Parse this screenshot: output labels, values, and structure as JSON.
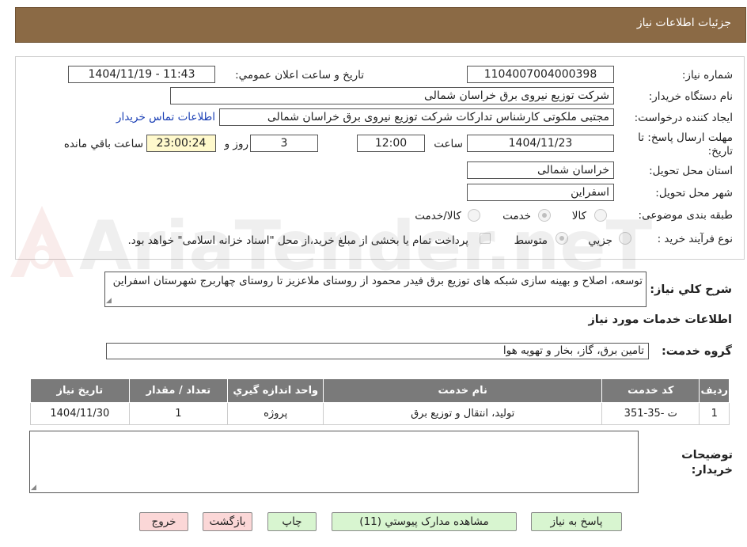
{
  "page": {
    "title": "جزئيات اطلاعات نياز"
  },
  "form": {
    "need_number_label": "شماره نياز:",
    "need_number": "1104007004000398",
    "announce_label": "تاريخ و ساعت اعلان عمومي:",
    "announce_value": "1404/11/19 - 11:43",
    "buyer_org_label": "نام دستگاه خريدار:",
    "buyer_org": "شرکت توزیع نیروی برق خراسان شمالی",
    "creator_label": "ايجاد کننده درخواست:",
    "creator": "مجتبی ملکوتی کارشناس تدارکات شرکت توزیع نیروی برق خراسان شمالی",
    "contact_link": "اطلاعات تماس خريدار",
    "deadline_label": "مهلت ارسال پاسخ: تا تاريخ:",
    "deadline_date": "1404/11/23",
    "time_label": "ساعت",
    "deadline_time": "12:00",
    "days_value": "3",
    "days_label": "روز و",
    "remaining_time": "23:00:24",
    "remaining_label": "ساعت باقي مانده",
    "province_label": "استان محل تحويل:",
    "province": "خراسان شمالی",
    "city_label": "شهر محل تحويل:",
    "city": "اسفراین",
    "category_label": "طبقه بندی موضوعی:",
    "category_options": [
      "کالا",
      "خدمت",
      "کالا/خدمت"
    ],
    "category_selected": "خدمت",
    "process_label": "نوع فرآيند خريد :",
    "process_options": [
      "جزيي",
      "متوسط"
    ],
    "process_selected": "متوسط",
    "payment_note": "پرداخت تمام یا بخشی از مبلغ خرید،از محل \"اسناد خزانه اسلامی\" خواهد بود."
  },
  "description": {
    "label": "شرح کلي نياز:",
    "text": "توسعه، اصلاح و بهینه سازی شبکه های توزیع برق فیدر محمود از روستای ملاعزیز تا روستای چهاربرج شهرستان اسفراین"
  },
  "services": {
    "section_title": "اطلاعات خدمات مورد نياز",
    "group_label": "گروه خدمت:",
    "group_value": "تامین برق، گاز، بخار و تهویه هوا",
    "columns": [
      "رديف",
      "کد خدمت",
      "نام خدمت",
      "واحد اندازه گيري",
      "تعداد / مقدار",
      "تاريخ نياز"
    ],
    "rows": [
      [
        "1",
        "ت -35-351",
        "تولید، انتقال و توزیع برق",
        "پروژه",
        "1",
        "1404/11/30"
      ]
    ]
  },
  "notes": {
    "label_line1": "توضيحات",
    "label_line2": "خريدار:",
    "text": ""
  },
  "buttons": {
    "reply": "پاسخ به نياز",
    "attachments": "مشاهده مدارک پيوستي (11)",
    "print": "چاپ",
    "back": "بازگشت",
    "exit": "خروج"
  },
  "watermark": {
    "text": "AriaTender.neT"
  },
  "colors": {
    "header": "#8b6a45",
    "table_header": "#7a7a7a",
    "button_green": "#d8f5d0",
    "button_pink": "#fbd7d7",
    "timer_bg": "#fff9cc",
    "link": "#1a3fb5"
  }
}
